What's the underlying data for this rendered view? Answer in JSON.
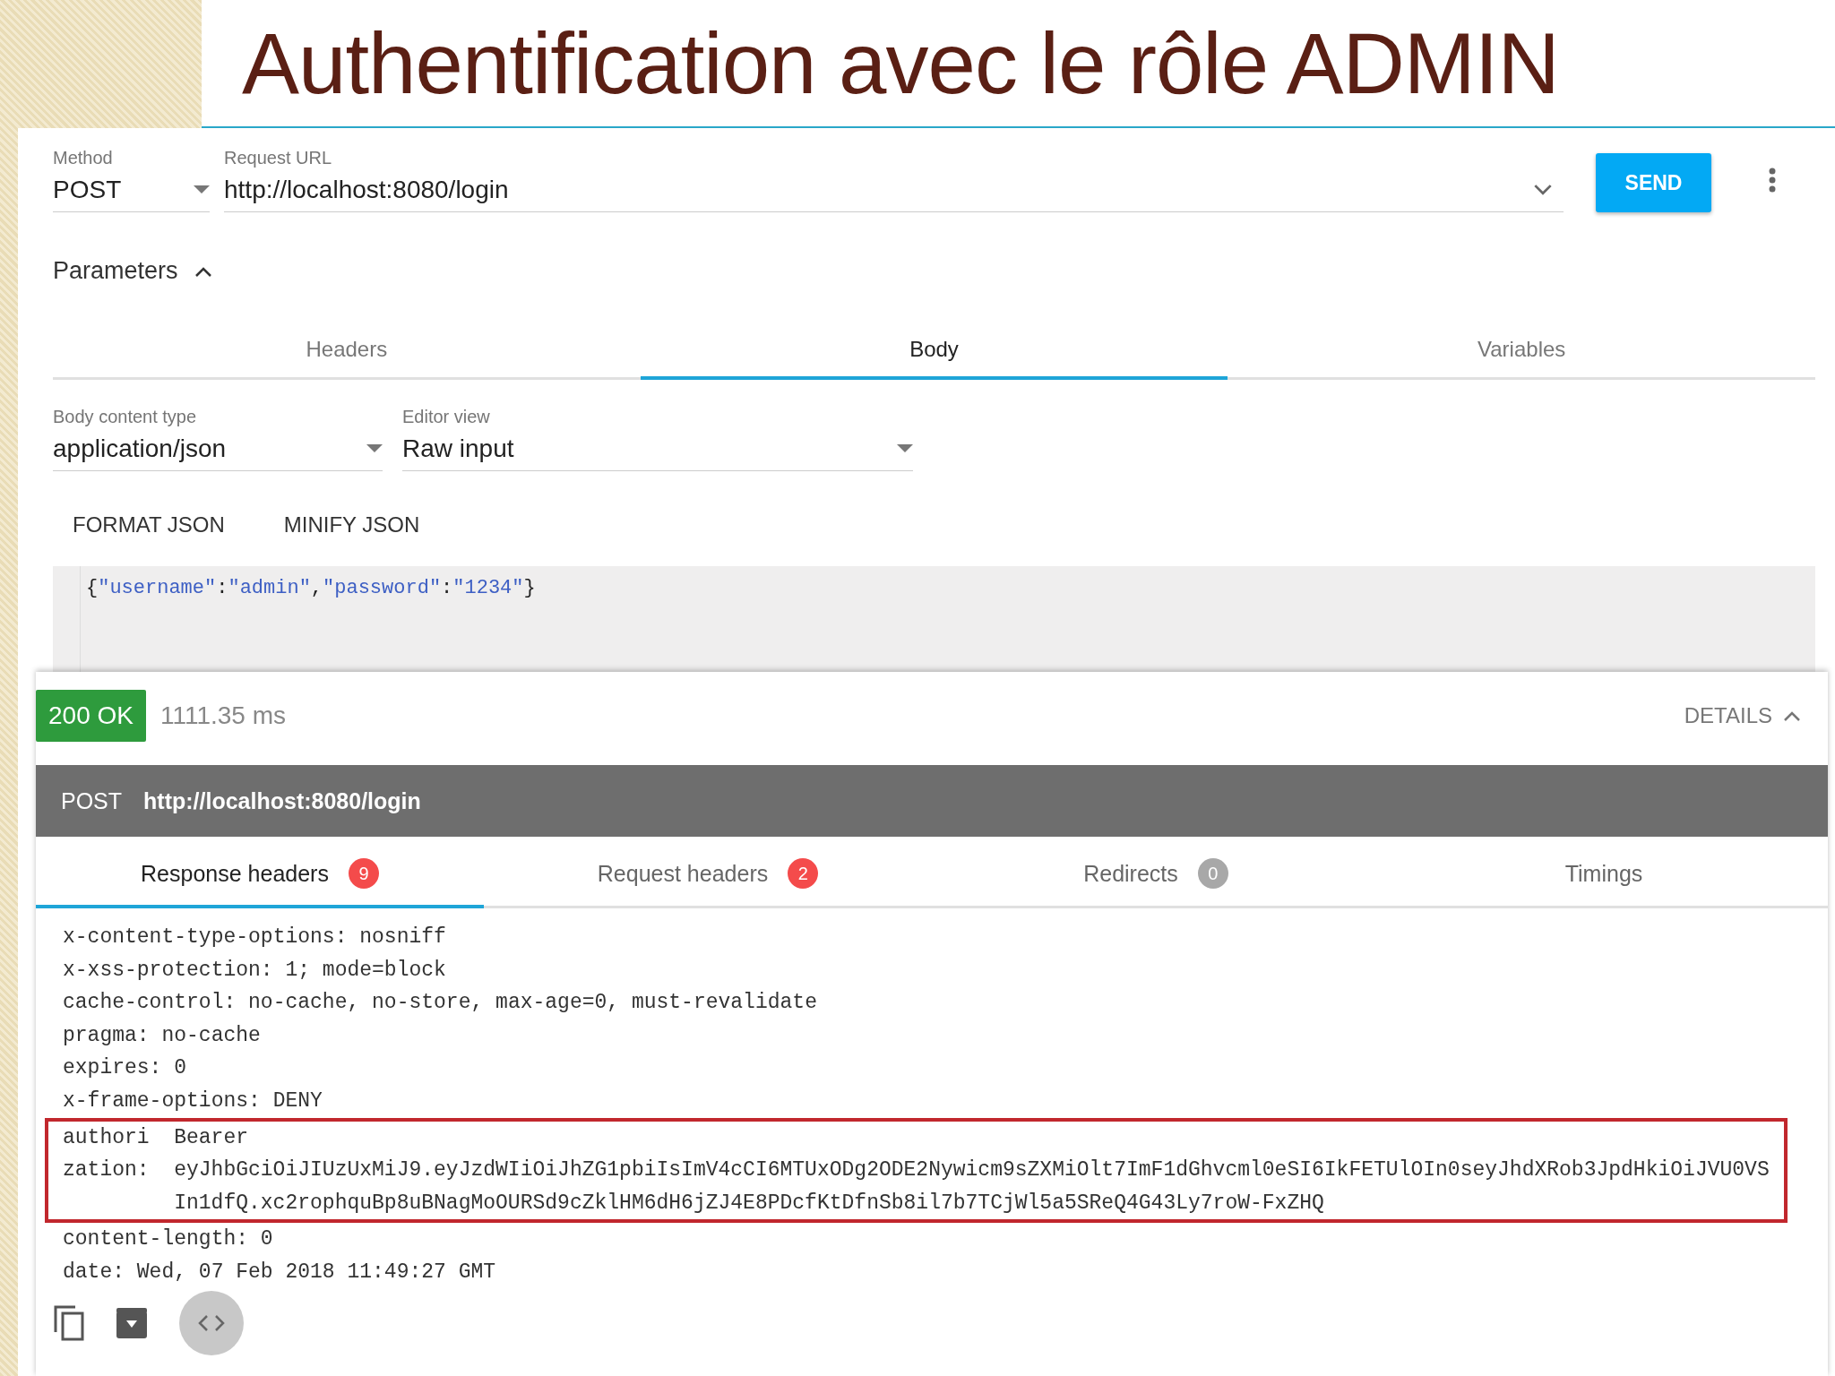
{
  "slide_title": "Authentification avec le rôle ADMIN",
  "request": {
    "method_label": "Method",
    "method": "POST",
    "url_label": "Request URL",
    "url": "http://localhost:8080/login",
    "send": "SEND"
  },
  "parameters": {
    "label": "Parameters",
    "expanded": true
  },
  "param_tabs": [
    {
      "label": "Headers",
      "selected": false
    },
    {
      "label": "Body",
      "selected": true
    },
    {
      "label": "Variables",
      "selected": false
    }
  ],
  "body_content_type": {
    "label": "Body content type",
    "value": "application/json"
  },
  "editor_view": {
    "label": "Editor view",
    "value": "Raw input"
  },
  "json_actions": [
    "FORMAT JSON",
    "MINIFY JSON"
  ],
  "body": "{\"username\":\"admin\",\"password\":\"1234\"}",
  "response": {
    "status": "200 OK",
    "time": "1111.35 ms",
    "details": "DETAILS",
    "method": "POST",
    "url": "http://localhost:8080/login"
  },
  "response_tabs": [
    {
      "label": "Response headers",
      "count": "9",
      "color": "#f44b4b",
      "selected": true
    },
    {
      "label": "Request headers",
      "count": "2",
      "color": "#f44b4b",
      "selected": false
    },
    {
      "label": "Redirects",
      "count": "0",
      "color": "#a8a8a8",
      "selected": false
    },
    {
      "label": "Timings",
      "selected": false
    }
  ],
  "headers": [
    {
      "name": "x-content-type-options:",
      "value": "nosniff",
      "highlighted": false
    },
    {
      "name": "x-xss-protection:",
      "value": "1; mode=block",
      "highlighted": false
    },
    {
      "name": "cache-control:",
      "value": "no-cache, no-store, max-age=0, must-revalidate",
      "highlighted": false
    },
    {
      "name": "pragma:",
      "value": "no-cache",
      "highlighted": false
    },
    {
      "name": "expires:",
      "value": "0",
      "highlighted": false
    },
    {
      "name": "x-frame-options:",
      "value": "DENY",
      "highlighted": false
    },
    {
      "name": "authorization:",
      "value": "Bearer eyJhbGciOiJIUzUxMiJ9.eyJzdWIiOiJhZG1pbiIsImV4cCI6MTUxODg2ODE2Nywicm9sZXMiOlt7ImF1dGhvcml0eSI6IkFETUlOIn0seyJhdXRob3JpdHkiOiJVU0VSIn1dfQ.xc2rophquBp8uBNagMoOURSd9cZklHM6dH6jZJ4E8PDcfKtDfnSb8il7b7TCjWl5a5SReQ4G43Ly7roW-FxZHQ",
      "highlighted": true
    },
    {
      "name": "content-length:",
      "value": "0",
      "highlighted": false
    },
    {
      "name": "date:",
      "value": "Wed, 07 Feb 2018 11:49:27 GMT",
      "highlighted": false
    }
  ]
}
